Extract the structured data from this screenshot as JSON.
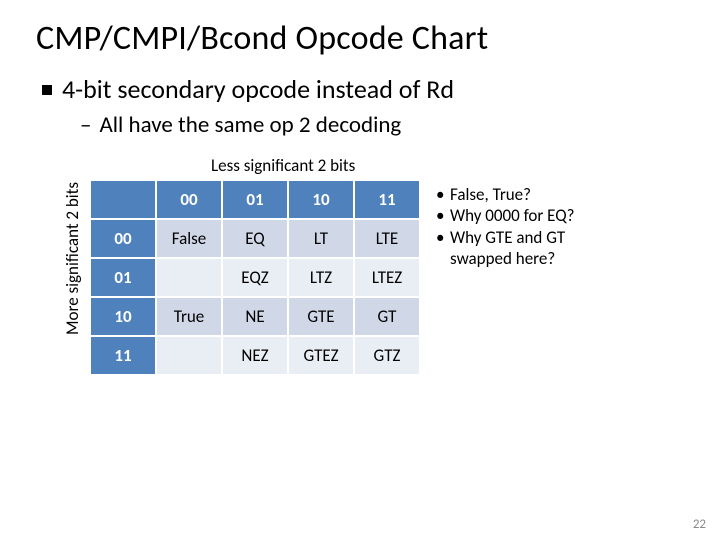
{
  "title": "CMP/CMPI/Bcond Opcode Chart",
  "bullet1": "4-bit secondary opcode instead of Rd",
  "bullet2": "All have the same op 2 decoding",
  "labels": {
    "top": "Less significant 2 bits",
    "left": "More significant 2 bits"
  },
  "table": {
    "col_headers": [
      "00",
      "01",
      "10",
      "11"
    ],
    "row_headers": [
      "00",
      "01",
      "10",
      "11"
    ],
    "cells": [
      [
        "False",
        "EQ",
        "LT",
        "LTE"
      ],
      [
        "",
        "EQZ",
        "LTZ",
        "LTEZ"
      ],
      [
        "True",
        "NE",
        "GTE",
        "GT"
      ],
      [
        "",
        "NEZ",
        "GTEZ",
        "GTZ"
      ]
    ]
  },
  "notes": [
    "False, True?",
    "Why 0000 for EQ?",
    "Why GTE and GT",
    "swapped here?"
  ],
  "page_number": "22",
  "chart_data": {
    "type": "table",
    "title": "CMP/CMPI/Bcond Opcode Chart",
    "row_axis": "More significant 2 bits",
    "col_axis": "Less significant 2 bits",
    "columns": [
      "00",
      "01",
      "10",
      "11"
    ],
    "rows": [
      "00",
      "01",
      "10",
      "11"
    ],
    "values": [
      [
        "False",
        "EQ",
        "LT",
        "LTE"
      ],
      [
        "",
        "EQZ",
        "LTZ",
        "LTEZ"
      ],
      [
        "True",
        "NE",
        "GTE",
        "GT"
      ],
      [
        "",
        "NEZ",
        "GTEZ",
        "GTZ"
      ]
    ]
  }
}
